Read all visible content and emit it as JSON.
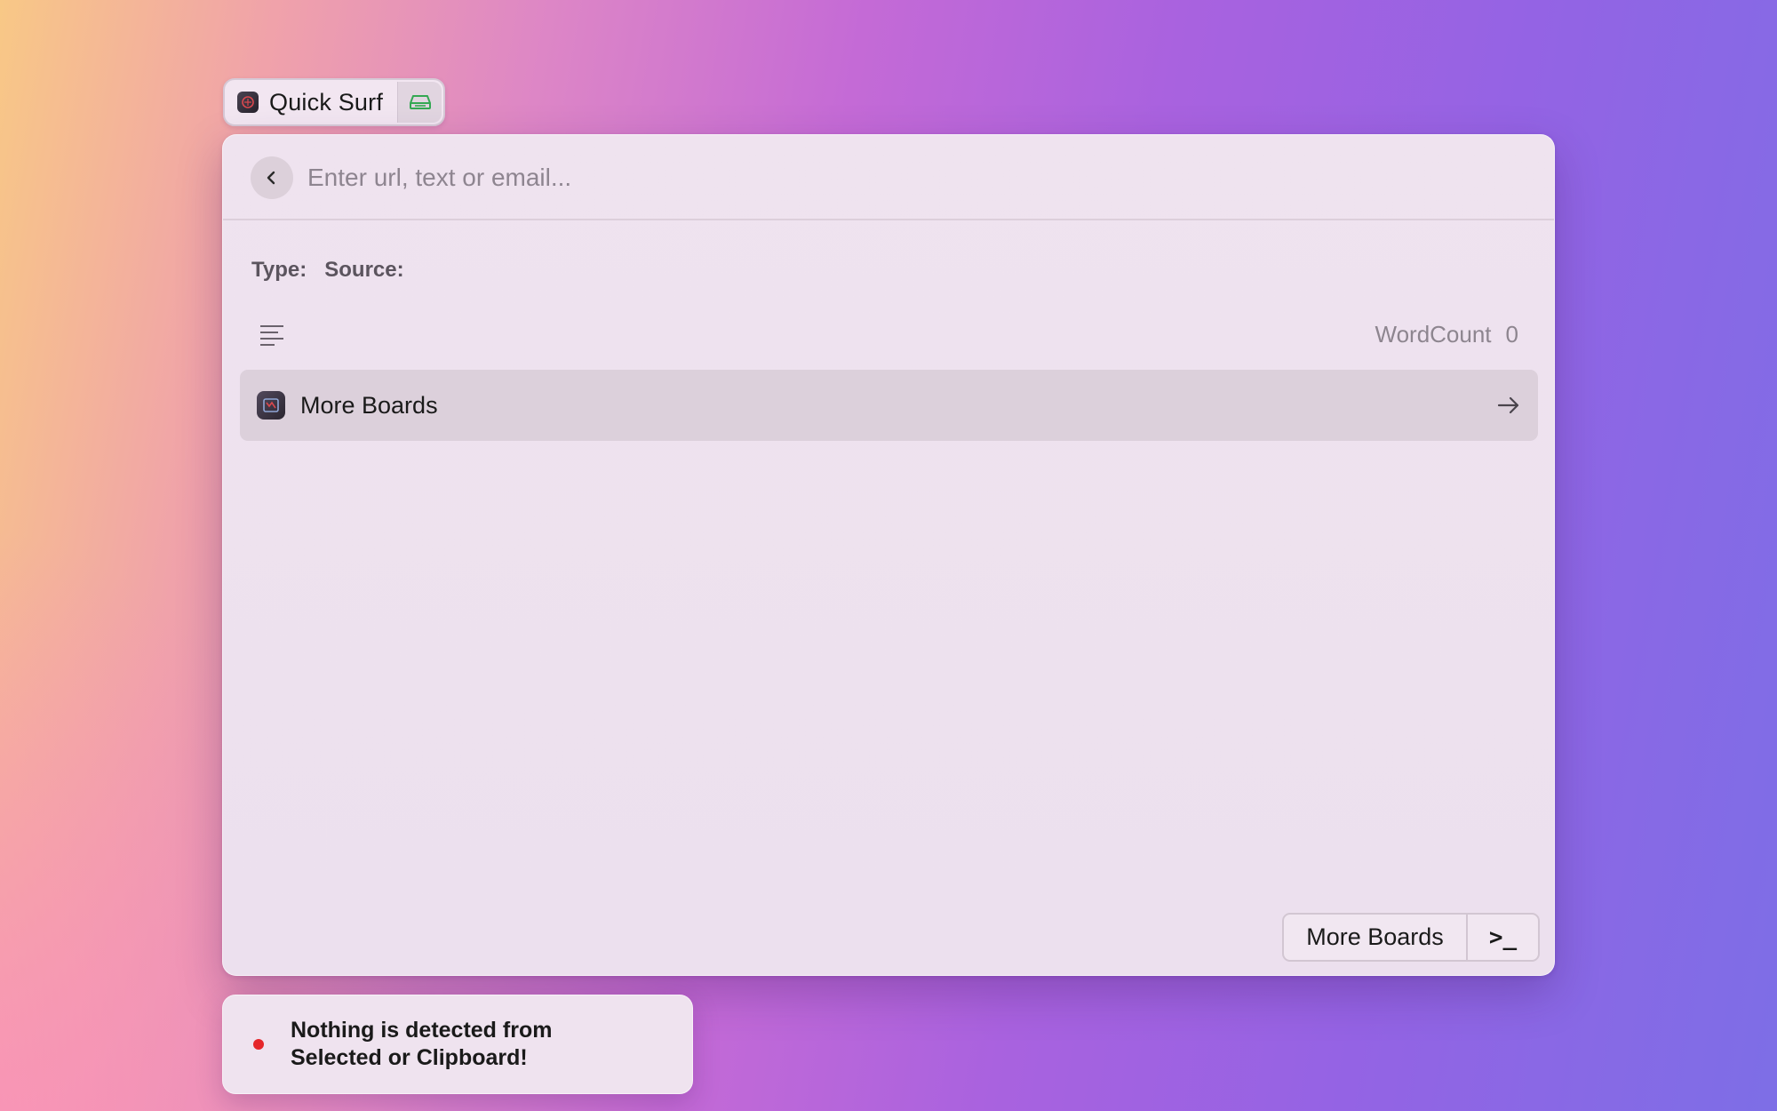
{
  "app": {
    "title": "Quick Surf",
    "icon": "quick-surf-app-icon",
    "pill_button_icon": "drive-icon",
    "pill_button_color": "#34a853"
  },
  "search": {
    "value": "",
    "placeholder": "Enter url, text or email..."
  },
  "meta": {
    "type_label": "Type:",
    "source_label": "Source:"
  },
  "stats": {
    "text_icon": "text-lines-icon",
    "wordcount_label": "WordCount",
    "wordcount_value": "0"
  },
  "list": {
    "items": [
      {
        "label": "More Boards",
        "icon": "boards-app-icon",
        "trailing_icon": "arrow-right-icon"
      }
    ]
  },
  "actions": {
    "primary_label": "More Boards",
    "secondary_label": ">_",
    "secondary_icon": "terminal-icon"
  },
  "toast": {
    "status_color": "#e5262a",
    "message": "Nothing is detected from Selected or Clipboard!"
  }
}
